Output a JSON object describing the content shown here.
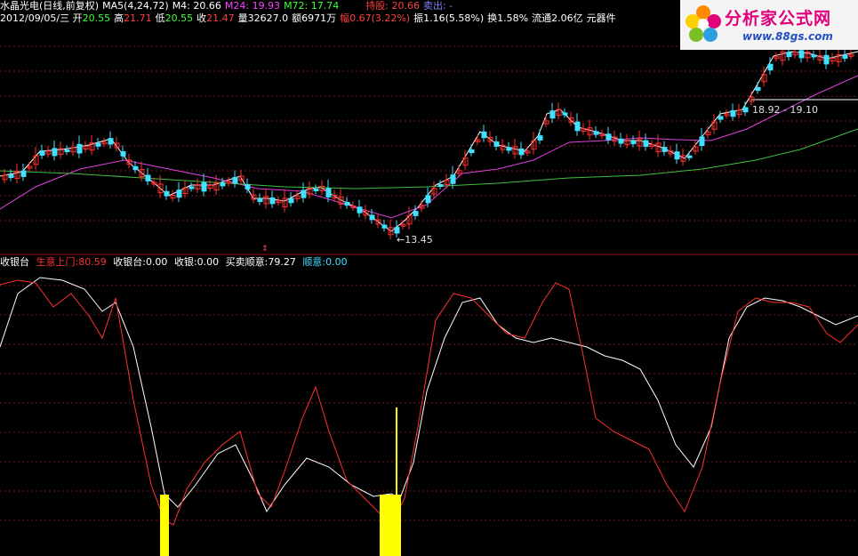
{
  "header": {
    "title": "水晶光电(日线,前复权)",
    "ma_label": "MA5(4,24,72)",
    "m4": "M4: 20.66",
    "m24": "M24: 19.93",
    "m72": "M72: 17.74",
    "position": "持股: 20.66",
    "sell": "卖出: -",
    "date": "2012/09/05/三",
    "open_label": "开",
    "open": "20.55",
    "high_label": "高",
    "high": "21.71",
    "low_label": "低",
    "low": "20.55",
    "close_label": "收",
    "close": "21.47",
    "volume": "量32627.0",
    "amount": "额6971万",
    "change": "幅0.67(3.22%)",
    "amplitude": "振1.16(5.58%)",
    "turnover": "换1.58%",
    "float": "流通2.06亿",
    "sector": "元器件"
  },
  "logo": {
    "title": "分析家公式网",
    "url": "www.88gs.com"
  },
  "price_annotations": {
    "low": "←13.45",
    "range": "18.92 - 19.10"
  },
  "indicator": {
    "name": "收银台",
    "s1_label": "生意上门:",
    "s1_value": "80.59",
    "s2_label": "收银台:",
    "s2_value": "0.00",
    "s3_label": "收银:",
    "s3_value": "0.00",
    "s4_label": "买卖顺意:",
    "s4_value": "79.27",
    "s5_label": "顺意:",
    "s5_value": "0.00"
  },
  "colors": {
    "up": "#ff3030",
    "down": "#40e0ff",
    "ma_white": "#e8e8e8",
    "ma_magenta": "#e040e0",
    "ma_green": "#40c040",
    "grid": "#7a1a1a",
    "signal": "#ffff00"
  }
}
